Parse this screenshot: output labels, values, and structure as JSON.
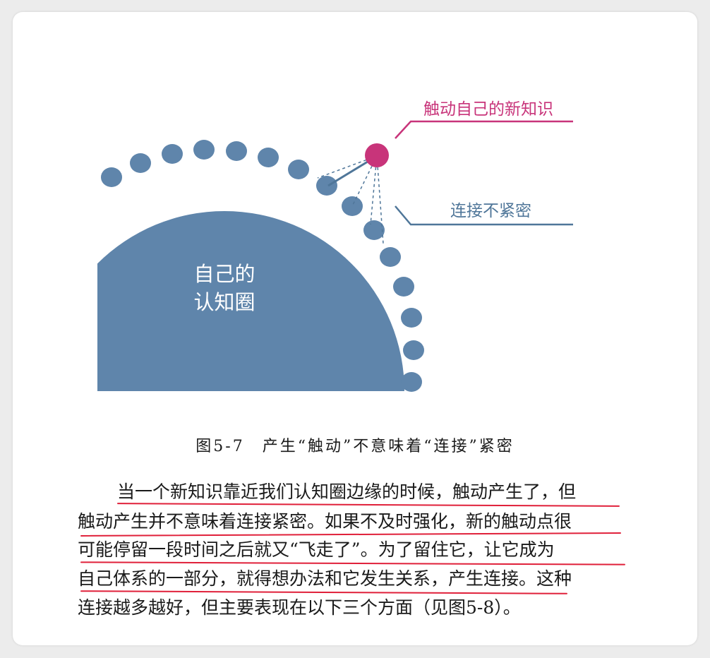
{
  "figure": {
    "inner_label_line1": "自己的",
    "inner_label_line2": "认知圈",
    "callout_top": "触动自己的新知识",
    "callout_bottom": "连接不紧密",
    "caption": "图5-7　产生“触动”不意味着“连接”紧密"
  },
  "paragraph": {
    "lines": [
      "当一个新知识靠近我们认知圈边缘的时候，触动产生了，但",
      "触动产生并不意味着连接紧密。如果不及时强化，新的触动点很",
      "可能停留一段时间之后就又“飞走了”。为了留住它，让它成为",
      "自己体系的一部分，就得想办法和它发生关系，产生连接。这种",
      "连接越多越好，但主要表现在以下三个方面（见图5-8）。"
    ]
  },
  "colors": {
    "circle_fill": "#5f85ab",
    "accent_magenta": "#c8347a",
    "callout_blue": "#4f7699",
    "underline_red": "#e0203a"
  }
}
